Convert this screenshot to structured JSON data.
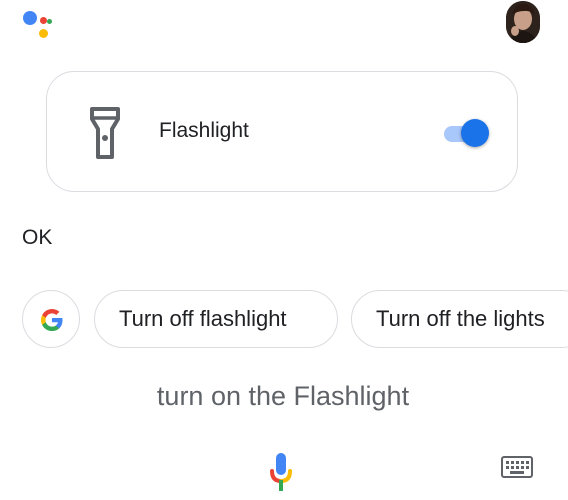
{
  "header": {
    "assistant_logo_icon": "google-assistant-icon",
    "avatar_icon": "user-avatar"
  },
  "card": {
    "icon": "flashlight-icon",
    "label": "Flashlight",
    "toggle_state": "on",
    "accent_color": "#1a73e8"
  },
  "reply": "OK",
  "suggestions": {
    "google_icon": "google-g-icon",
    "chips": [
      "Turn off flashlight",
      "Turn off the lights"
    ]
  },
  "query": "turn on the Flashlight",
  "footer": {
    "mic_icon": "microphone-icon",
    "keyboard_icon": "keyboard-icon"
  }
}
